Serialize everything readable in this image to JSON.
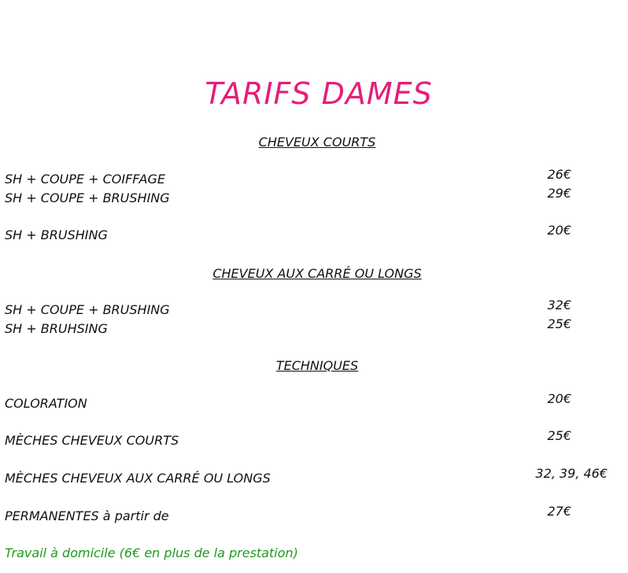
{
  "title": "TARIFS DAMES",
  "sections": [
    {
      "heading": "CHEVEUX COURTS",
      "rows": [
        {
          "label": "SH + COUPE + COIFFAGE",
          "price": "26€"
        },
        {
          "label": "SH + COUPE + BRUSHING",
          "price": "29€"
        },
        {
          "label": "SH + BRUSHING",
          "price": "20€"
        }
      ]
    },
    {
      "heading": "CHEVEUX AUX CARRÉ OU LONGS",
      "rows": [
        {
          "label": "SH + COUPE + BRUSHING",
          "price": "32€"
        },
        {
          "label": "SH + BRUHSING",
          "price": "25€"
        }
      ]
    },
    {
      "heading": "TECHNIQUES",
      "rows": [
        {
          "label": "COLORATION",
          "price": "20€"
        },
        {
          "label": "MÈCHES CHEVEUX COURTS",
          "price": "25€"
        },
        {
          "label": "MÈCHES CHEVEUX AUX CARRÉ OU LONGS",
          "price": "32, 39, 46€"
        },
        {
          "label": "PERMANENTES à partir de",
          "price": "27€"
        }
      ]
    }
  ],
  "note": "Travail à domicile (6€ en plus de la prestation)",
  "colors": {
    "title": "#e61e78",
    "note": "#1f9a1f",
    "text": "#111111"
  }
}
